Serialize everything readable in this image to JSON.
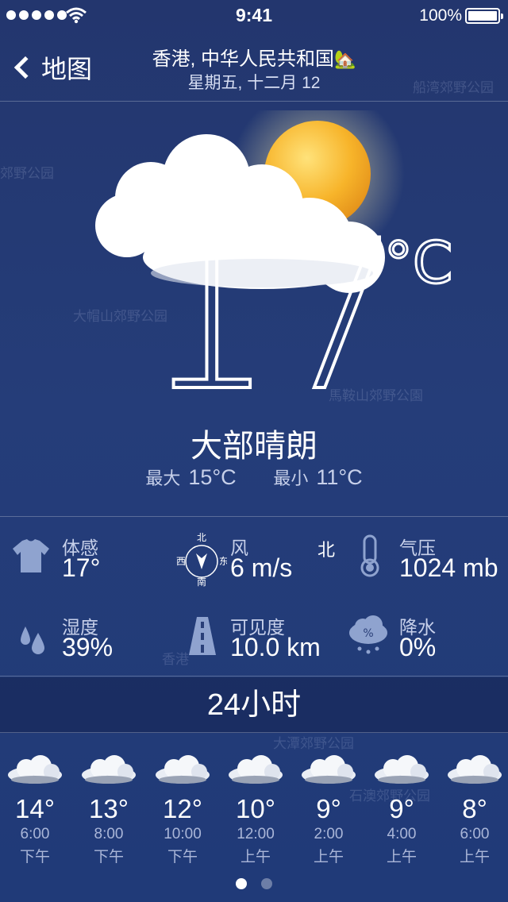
{
  "status_bar": {
    "time": "9:41",
    "battery": "100%"
  },
  "nav": {
    "back_label": "地图",
    "title": "香港, 中华人民共和国",
    "title_emoji": "🏡",
    "subtitle": "星期五, 十二月 12"
  },
  "map_labels": [
    "船湾郊野公园",
    "郊野公园",
    "大帽山郊野公园",
    "馬鞍山郊野公園",
    "香港",
    "大潭郊野公园",
    "石澳郊野公园"
  ],
  "current": {
    "temp": "17",
    "unit": "°C",
    "condition": "大部晴朗",
    "max_label": "最大",
    "max_value": "15°C",
    "min_label": "最小",
    "min_value": "11°C"
  },
  "details": {
    "feels_like": {
      "label": "体感",
      "value": "17°",
      "icon": "tshirt-icon"
    },
    "wind": {
      "label": "风",
      "value": "6 m/s",
      "direction": "北",
      "icon": "compass-icon",
      "compass": {
        "n": "北",
        "s": "南",
        "w": "西",
        "e": "东"
      }
    },
    "pressure": {
      "label": "气压",
      "value": "1024 mb",
      "icon": "thermometer-icon"
    },
    "humidity": {
      "label": "湿度",
      "value": "39%",
      "icon": "droplets-icon"
    },
    "visibility": {
      "label": "可见度",
      "value": "10.0 km",
      "icon": "road-icon"
    },
    "precipitation": {
      "label": "降水",
      "value": "0%",
      "icon": "rain-cloud-icon"
    }
  },
  "hourly": {
    "title": "24小时",
    "items": [
      {
        "temp": "14°",
        "time": "6:00",
        "ampm": "下午"
      },
      {
        "temp": "13°",
        "time": "8:00",
        "ampm": "下午"
      },
      {
        "temp": "12°",
        "time": "10:00",
        "ampm": "下午"
      },
      {
        "temp": "10°",
        "time": "12:00",
        "ampm": "上午"
      },
      {
        "temp": "9°",
        "time": "2:00",
        "ampm": "上午"
      },
      {
        "temp": "9°",
        "time": "4:00",
        "ampm": "上午"
      },
      {
        "temp": "8°",
        "time": "6:00",
        "ampm": "上午"
      }
    ]
  },
  "pager": {
    "pages": 2,
    "active": 0
  },
  "colors": {
    "background": "#23366e",
    "sun": "#f2a81d",
    "text_secondary": "#c7d0ea"
  }
}
